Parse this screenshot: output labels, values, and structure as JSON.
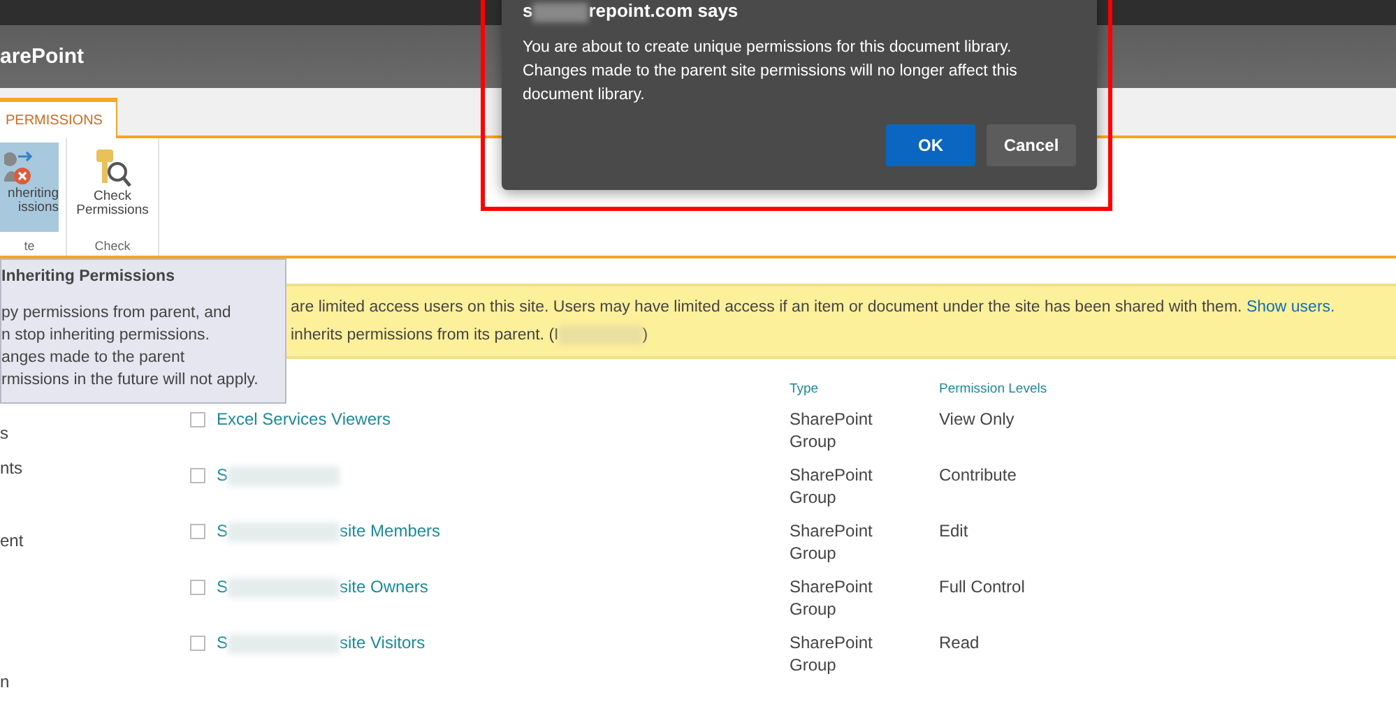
{
  "suite_bar": {
    "title": "arePoint"
  },
  "ribbon": {
    "tabs": [
      {
        "label": "PERMISSIONS",
        "selected": true
      }
    ],
    "groups": [
      {
        "label": "te",
        "buttons": [
          {
            "label_lines": [
              "nheriting",
              "issions"
            ],
            "kind": "stop",
            "pressed": true
          }
        ]
      },
      {
        "label": "Check",
        "buttons": [
          {
            "label_lines": [
              "Check",
              "Permissions"
            ],
            "kind": "check",
            "pressed": false
          }
        ]
      }
    ]
  },
  "tooltip": {
    "title": "Inheriting Permissions",
    "lines": [
      "py permissions from parent, and",
      "n stop inheriting permissions.",
      "anges made to the parent",
      "rmissions in the future will not apply."
    ]
  },
  "left_nav": [
    "s",
    "nts",
    "ent",
    "n"
  ],
  "banner": {
    "text": "are limited access users on this site. Users may have limited access if an item or document under the site has been shared with them.",
    "link": "Show users.",
    "line2_start": "inherits permissions from its parent. (I",
    "line2_end": ")"
  },
  "table": {
    "columns": [
      "Type",
      "Permission Levels"
    ],
    "rows": [
      {
        "name_start": "Excel Services Viewers",
        "redacted": false,
        "name_end": "",
        "checked": false,
        "type": "SharePoint Group",
        "level": "View Only"
      },
      {
        "name_start": "S",
        "redacted": true,
        "name_end": "",
        "checked": false,
        "type": "SharePoint Group",
        "level": "Contribute"
      },
      {
        "name_start": "S",
        "redacted": true,
        "name_end": "site Members",
        "checked": false,
        "type": "SharePoint Group",
        "level": "Edit"
      },
      {
        "name_start": "S",
        "redacted": true,
        "name_end": "site Owners",
        "checked": false,
        "type": "SharePoint Group",
        "level": "Full Control"
      },
      {
        "name_start": "S",
        "redacted": true,
        "name_end": "site Visitors",
        "checked": false,
        "type": "SharePoint Group",
        "level": "Read"
      }
    ]
  },
  "dialog": {
    "title_start": "s",
    "title_end": "repoint.com says",
    "message": "You are about to create unique permissions for this document library. Changes made to the parent site permissions will no longer affect this document library.",
    "buttons": [
      {
        "label": "OK",
        "kind": "primary"
      },
      {
        "label": "Cancel",
        "kind": "secondary"
      }
    ]
  }
}
